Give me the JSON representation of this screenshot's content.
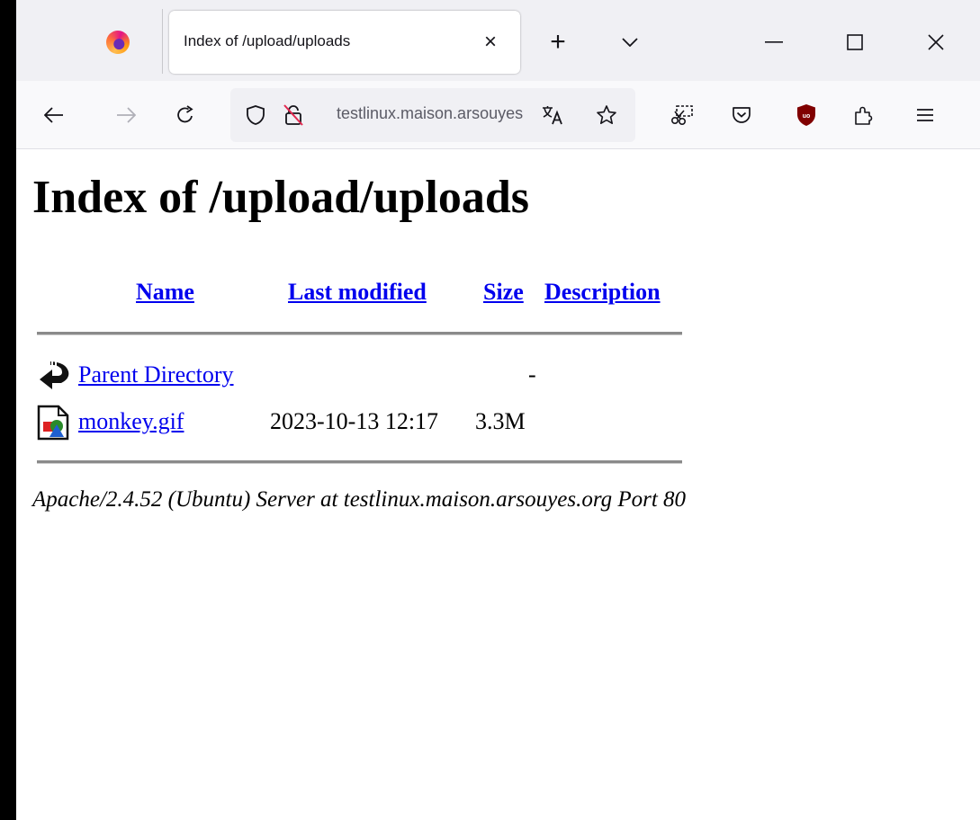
{
  "browser": {
    "tab_title": "Index of /upload/uploads",
    "tab_close": "×",
    "new_tab": "+",
    "url": "testlinux.maison.arsouyes.org/upload/uploads/"
  },
  "page": {
    "title": "Index of /upload/uploads",
    "columns": [
      "Name",
      "Last modified",
      "Size",
      "Description"
    ],
    "rows": [
      {
        "name": "Parent Directory",
        "modified": "",
        "size": "-",
        "description": "",
        "icon": "back-arrow-icon"
      },
      {
        "name": "monkey.gif",
        "modified": "2023-10-13 12:17",
        "size": "3.3M",
        "description": "",
        "icon": "image-file-icon"
      }
    ],
    "address": "Apache/2.4.52 (Ubuntu) Server at testlinux.maison.arsouyes.org Port 80"
  }
}
